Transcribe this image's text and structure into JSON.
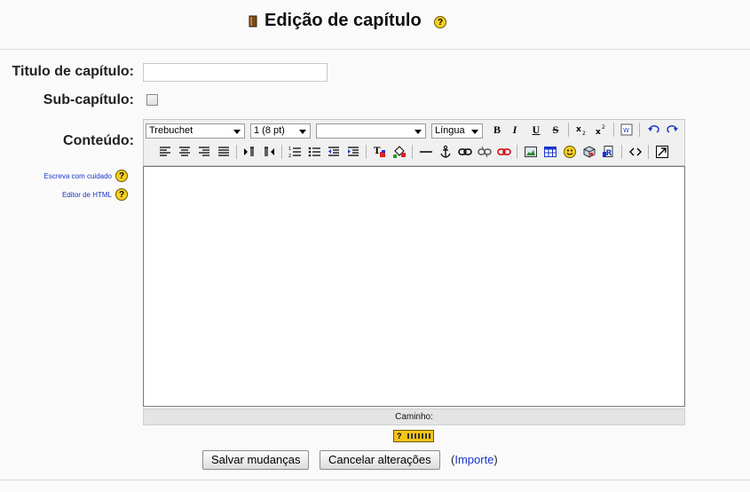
{
  "page": {
    "title": "Edição de capítulo"
  },
  "form": {
    "title_label": "Titulo de capítulo:",
    "title_value": "",
    "subchapter_label": "Sub-capítulo:",
    "subchapter_checked": false,
    "content_label": "Conteúdo:",
    "help_links": [
      "Escreva com cuidado",
      "Editor de HTML"
    ]
  },
  "editor": {
    "font_select": "Trebuchet",
    "size_select": "1 (8 pt)",
    "format_select": "",
    "language_select": "Língua",
    "bold_label": "B",
    "italic_label": "I",
    "underline_label": "U",
    "strike_label": "S",
    "status_label": "Caminho:",
    "content": ""
  },
  "actions": {
    "save_label": "Salvar mudanças",
    "cancel_label": "Cancelar alterações",
    "import_open": "(",
    "import_label": "Importe",
    "import_close": ")"
  },
  "colors": {
    "link": "#1a35c9",
    "help_icon": "#f5d020"
  }
}
